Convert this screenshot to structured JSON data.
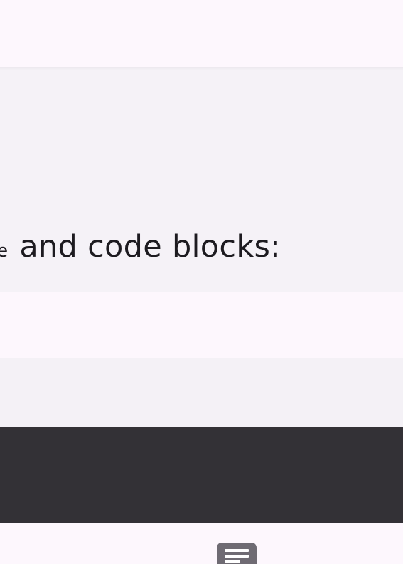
{
  "content": {
    "inline_code": "de",
    "text_after_code": "and code blocks:"
  },
  "bottom_bar": {
    "toc_icon": "toc-icon"
  },
  "colors": {
    "page_background": "#fdf7fd",
    "content_surface": "#f5f2f7",
    "code_block_dark": "#333136",
    "toc_button": "#6f6b73",
    "text": "#1d1b20"
  }
}
